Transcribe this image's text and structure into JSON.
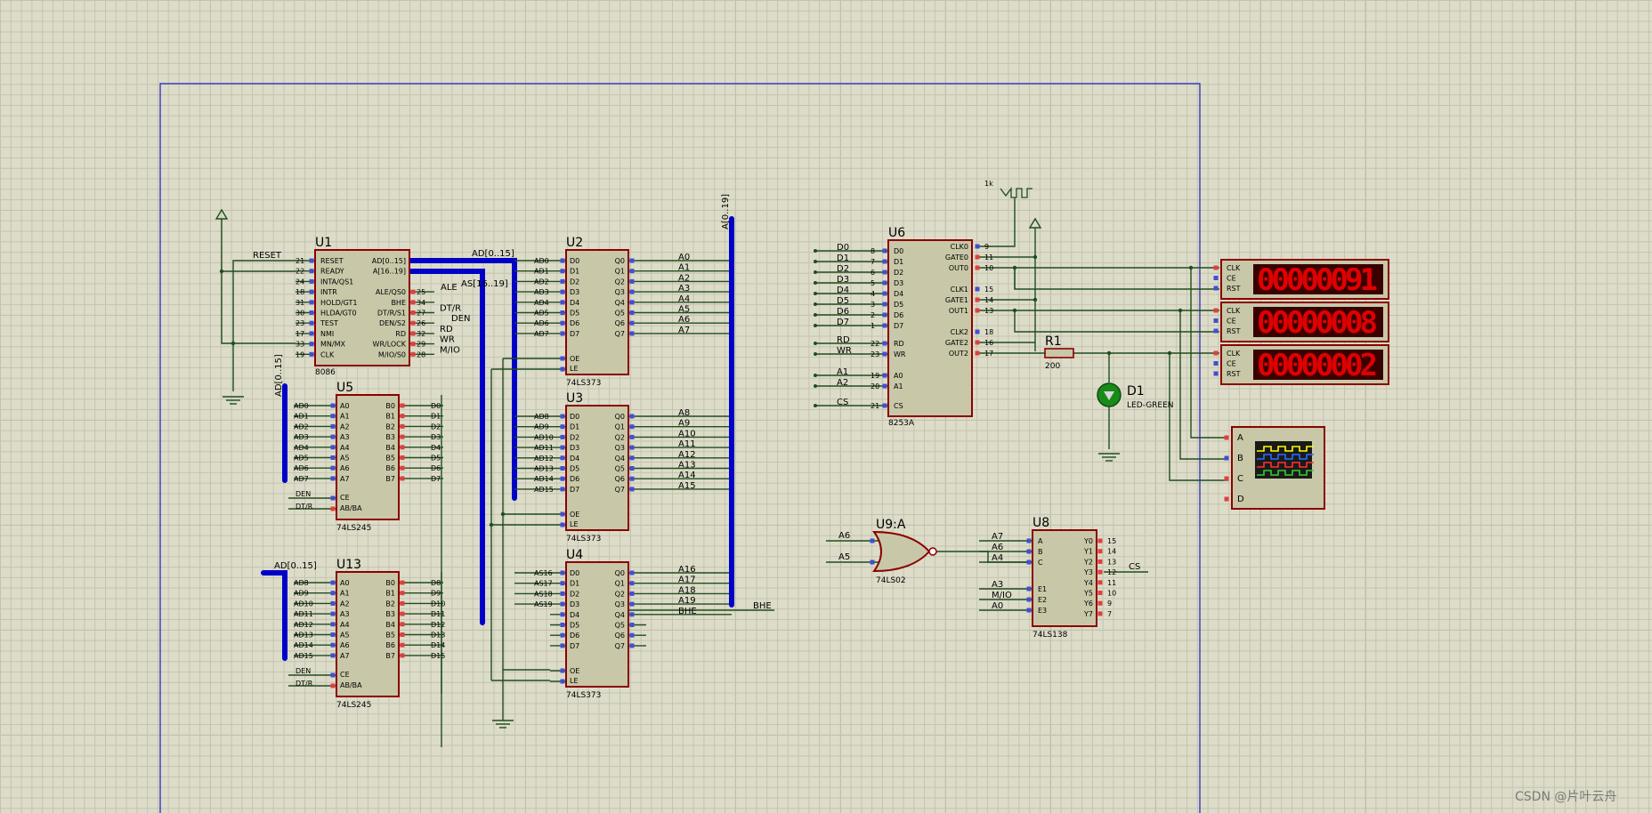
{
  "watermark": "CSDN @片叶云舟",
  "clock": {
    "label": "1k"
  },
  "chips": {
    "u1": {
      "ref": "U1",
      "type": "8086",
      "left_pins": [
        "RESET",
        "READY",
        "INTA/QS1",
        "INTR",
        "HOLD/GT1",
        "HLDA/GT0",
        "TEST",
        "NMI",
        "MN/MX",
        "CLK"
      ],
      "left_nums": [
        "21",
        "22",
        "24",
        "18",
        "31",
        "30",
        "23",
        "17",
        "33",
        "19"
      ],
      "right_pins": [
        "AD[0..15]",
        "A[16..19]",
        "",
        "ALE/QS0",
        "BHE",
        "DT/R/S1",
        "DEN/S2",
        "RD",
        "WR/LOCK",
        "M/IO/S0"
      ],
      "right_nums": [
        "",
        "",
        "",
        "25",
        "34",
        "27",
        "26",
        "32",
        "29",
        "28"
      ],
      "ext_labels": [
        "ALE",
        "DT/R",
        "DEN",
        "RD",
        "WR",
        "M/IO"
      ]
    },
    "u2": {
      "ref": "U2",
      "type": "74LS373",
      "in_labels": [
        "AD0",
        "AD1",
        "AD2",
        "AD3",
        "AD4",
        "AD5",
        "AD6",
        "AD7"
      ],
      "out_labels": [
        "A0",
        "A1",
        "A2",
        "A3",
        "A4",
        "A5",
        "A6",
        "A7"
      ]
    },
    "u3": {
      "ref": "U3",
      "type": "74LS373",
      "in_labels": [
        "AD8",
        "AD9",
        "AD10",
        "AD11",
        "AD12",
        "AD13",
        "AD14",
        "AD15"
      ],
      "out_labels": [
        "A8",
        "A9",
        "A10",
        "A11",
        "A12",
        "A13",
        "A14",
        "A15"
      ]
    },
    "u4": {
      "ref": "U4",
      "type": "74LS373",
      "in_labels": [
        "AS16",
        "AS17",
        "AS18",
        "AS19",
        "",
        "",
        "",
        ""
      ],
      "out_labels": [
        "A16",
        "A17",
        "A18",
        "A19",
        "BHE",
        "",
        "",
        ""
      ]
    },
    "u5": {
      "ref": "U5",
      "type": "74LS245",
      "in_labels": [
        "AD0",
        "AD1",
        "AD2",
        "AD3",
        "AD4",
        "AD5",
        "AD6",
        "AD7"
      ],
      "out_labels": [
        "D0",
        "D1",
        "D2",
        "D3",
        "D4",
        "D5",
        "D6",
        "D7"
      ],
      "ctl_labels": [
        "DEN",
        "DT/R"
      ]
    },
    "u13": {
      "ref": "U13",
      "type": "74LS245",
      "in_labels": [
        "AD8",
        "AD9",
        "AD10",
        "AD11",
        "AD12",
        "AD13",
        "AD14",
        "AD15"
      ],
      "out_labels": [
        "D8",
        "D9",
        "D10",
        "D11",
        "D12",
        "D13",
        "D14",
        "D15"
      ],
      "ctl_labels": [
        "DEN",
        "DT/R"
      ]
    },
    "u6": {
      "ref": "U6",
      "type": "8253A",
      "left_pins": [
        "D0",
        "D1",
        "D2",
        "D3",
        "D4",
        "D5",
        "D6",
        "D7",
        "RD",
        "WR",
        "A0",
        "A1",
        "CS"
      ],
      "left_nums": [
        "8",
        "7",
        "6",
        "5",
        "4",
        "3",
        "2",
        "1",
        "22",
        "23",
        "19",
        "20",
        "21"
      ],
      "ext_labels": [
        "D0",
        "D1",
        "D2",
        "D3",
        "D4",
        "D5",
        "D6",
        "D7",
        "RD",
        "WR",
        "A1",
        "A2",
        "CS"
      ],
      "right_pins": [
        "CLK0",
        "GATE0",
        "OUT0",
        "CLK1",
        "GATE1",
        "OUT1",
        "CLK2",
        "GATE2",
        "OUT2"
      ],
      "right_nums": [
        "9",
        "11",
        "10",
        "15",
        "14",
        "13",
        "18",
        "16",
        "17"
      ]
    },
    "u8": {
      "ref": "U8",
      "type": "74LS138",
      "in_pins": [
        "A",
        "B",
        "C",
        "E1",
        "E2",
        "E3"
      ],
      "in_labels": [
        "A7",
        "A6",
        "A4",
        "A3",
        "M/IO",
        "A0"
      ],
      "out_pins": [
        "Y0",
        "Y1",
        "Y2",
        "Y3",
        "Y4",
        "Y5",
        "Y6",
        "Y7"
      ],
      "out_nums": [
        "15",
        "14",
        "13",
        "12",
        "11",
        "10",
        "9",
        "7"
      ],
      "cs_label": "CS"
    },
    "u9": {
      "ref": "U9:A",
      "type": "74LS02",
      "in_labels": [
        "A6",
        "A5"
      ]
    }
  },
  "r1": {
    "ref": "R1",
    "value": "200"
  },
  "d1": {
    "ref": "D1",
    "value": "LED-GREEN"
  },
  "counters": [
    {
      "value": "00000091",
      "pins": [
        "CLK",
        "CE",
        "RST"
      ]
    },
    {
      "value": "00000008",
      "pins": [
        "CLK",
        "CE",
        "RST"
      ]
    },
    {
      "value": "00000002",
      "pins": [
        "CLK",
        "CE",
        "RST"
      ]
    }
  ],
  "scope": {
    "channels": [
      "A",
      "B",
      "C",
      "D"
    ]
  },
  "bus_labels": {
    "ad_bus": "AD[0..15]",
    "as_bus": "AS[16..19]",
    "a_bus": "A[0..19]",
    "ad_u5": "AD[0..15]",
    "ad_u13": "AD[0..15]",
    "reset": "RESET"
  }
}
